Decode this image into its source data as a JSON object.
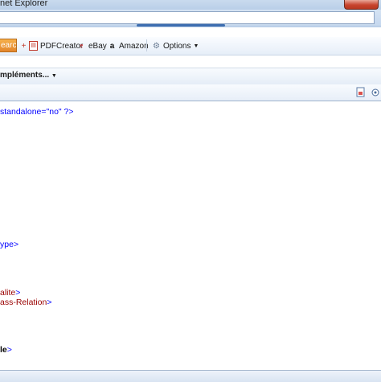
{
  "window": {
    "title": "net Explorer"
  },
  "links": {
    "search_label": "earch",
    "pdfcreator": "PDFCreator",
    "ebay": "eBay",
    "amazon": "Amazon",
    "options": "Options"
  },
  "command": {
    "complements": "mpléments..."
  },
  "xml": {
    "line1": "standalone=\"no\" ?>",
    "line2_name": "ype",
    "line3_name": "alite",
    "line4_name": "ass-Relation",
    "line5_name": "le"
  },
  "colors": {
    "tag": "#990000",
    "pi": "#0000ff",
    "accent": "#3d6eb0"
  }
}
